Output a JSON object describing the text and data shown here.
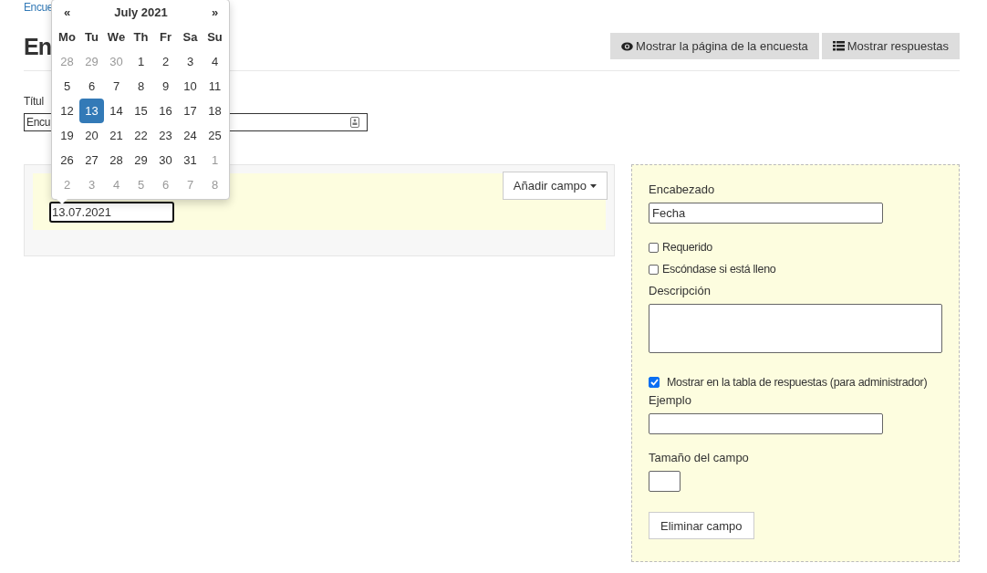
{
  "breadcrumb": {
    "link": "Encue"
  },
  "heading": "En",
  "header_buttons": [
    {
      "kind": "eye",
      "label": "Mostrar la página de la encuesta"
    },
    {
      "kind": "list",
      "label": "Mostrar respuestas"
    }
  ],
  "title_field": {
    "label": "Títul",
    "value": "Encu"
  },
  "builder": {
    "add_button": "Añadir campo",
    "date_value": "13.07.2021"
  },
  "datepicker": {
    "prev": "«",
    "month_title": "July 2021",
    "next": "»",
    "weekdays": [
      "Mo",
      "Tu",
      "We",
      "Th",
      "Fr",
      "Sa",
      "Su"
    ],
    "weeks": [
      [
        {
          "day": "28",
          "muted": true,
          "selected": false
        },
        {
          "day": "29",
          "muted": true,
          "selected": false
        },
        {
          "day": "30",
          "muted": true,
          "selected": false
        },
        {
          "day": "1",
          "muted": false,
          "selected": false
        },
        {
          "day": "2",
          "muted": false,
          "selected": false
        },
        {
          "day": "3",
          "muted": false,
          "selected": false
        },
        {
          "day": "4",
          "muted": false,
          "selected": false
        }
      ],
      [
        {
          "day": "5",
          "muted": false,
          "selected": false
        },
        {
          "day": "6",
          "muted": false,
          "selected": false
        },
        {
          "day": "7",
          "muted": false,
          "selected": false
        },
        {
          "day": "8",
          "muted": false,
          "selected": false
        },
        {
          "day": "9",
          "muted": false,
          "selected": false
        },
        {
          "day": "10",
          "muted": false,
          "selected": false
        },
        {
          "day": "11",
          "muted": false,
          "selected": false
        }
      ],
      [
        {
          "day": "12",
          "muted": false,
          "selected": false
        },
        {
          "day": "13",
          "muted": false,
          "selected": true
        },
        {
          "day": "14",
          "muted": false,
          "selected": false
        },
        {
          "day": "15",
          "muted": false,
          "selected": false
        },
        {
          "day": "16",
          "muted": false,
          "selected": false
        },
        {
          "day": "17",
          "muted": false,
          "selected": false
        },
        {
          "day": "18",
          "muted": false,
          "selected": false
        }
      ],
      [
        {
          "day": "19",
          "muted": false,
          "selected": false
        },
        {
          "day": "20",
          "muted": false,
          "selected": false
        },
        {
          "day": "21",
          "muted": false,
          "selected": false
        },
        {
          "day": "22",
          "muted": false,
          "selected": false
        },
        {
          "day": "23",
          "muted": false,
          "selected": false
        },
        {
          "day": "24",
          "muted": false,
          "selected": false
        },
        {
          "day": "25",
          "muted": false,
          "selected": false
        }
      ],
      [
        {
          "day": "26",
          "muted": false,
          "selected": false
        },
        {
          "day": "27",
          "muted": false,
          "selected": false
        },
        {
          "day": "28",
          "muted": false,
          "selected": false
        },
        {
          "day": "29",
          "muted": false,
          "selected": false
        },
        {
          "day": "30",
          "muted": false,
          "selected": false
        },
        {
          "day": "31",
          "muted": false,
          "selected": false
        },
        {
          "day": "1",
          "muted": true,
          "selected": false
        }
      ],
      [
        {
          "day": "2",
          "muted": true,
          "selected": false
        },
        {
          "day": "3",
          "muted": true,
          "selected": false
        },
        {
          "day": "4",
          "muted": true,
          "selected": false
        },
        {
          "day": "5",
          "muted": true,
          "selected": false
        },
        {
          "day": "6",
          "muted": true,
          "selected": false
        },
        {
          "day": "7",
          "muted": true,
          "selected": false
        },
        {
          "day": "8",
          "muted": true,
          "selected": false
        }
      ]
    ]
  },
  "properties": {
    "items": [
      {
        "kind": "text",
        "label": "Encabezado",
        "value": "Fecha"
      },
      {
        "kind": "checkbox",
        "label": "Requerido",
        "checked": false
      },
      {
        "kind": "checkbox",
        "label": "Escóndase si está lleno",
        "checked": false
      },
      {
        "kind": "textarea",
        "label": "Descripción"
      },
      {
        "kind": "checkbox",
        "label": "Mostrar en la tabla de respuestas (para administrador)",
        "checked": true
      },
      {
        "kind": "text",
        "label": "Ejemplo"
      },
      {
        "kind": "small",
        "label": "Tamaño del campo"
      }
    ],
    "delete_button": "Eliminar campo"
  }
}
